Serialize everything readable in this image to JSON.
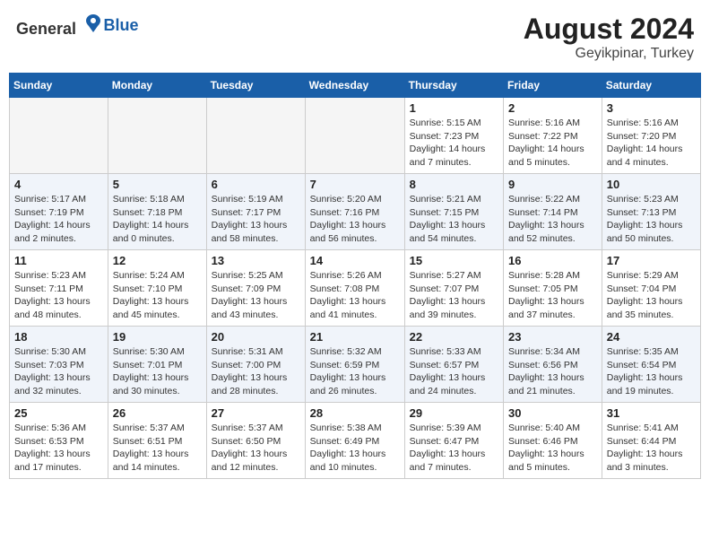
{
  "header": {
    "logo_general": "General",
    "logo_blue": "Blue",
    "month_year": "August 2024",
    "location": "Geyikpinar, Turkey"
  },
  "weekdays": [
    "Sunday",
    "Monday",
    "Tuesday",
    "Wednesday",
    "Thursday",
    "Friday",
    "Saturday"
  ],
  "weeks": [
    {
      "days": [
        {
          "date": "",
          "info": ""
        },
        {
          "date": "",
          "info": ""
        },
        {
          "date": "",
          "info": ""
        },
        {
          "date": "",
          "info": ""
        },
        {
          "date": "1",
          "info": "Sunrise: 5:15 AM\nSunset: 7:23 PM\nDaylight: 14 hours\nand 7 minutes."
        },
        {
          "date": "2",
          "info": "Sunrise: 5:16 AM\nSunset: 7:22 PM\nDaylight: 14 hours\nand 5 minutes."
        },
        {
          "date": "3",
          "info": "Sunrise: 5:16 AM\nSunset: 7:20 PM\nDaylight: 14 hours\nand 4 minutes."
        }
      ]
    },
    {
      "days": [
        {
          "date": "4",
          "info": "Sunrise: 5:17 AM\nSunset: 7:19 PM\nDaylight: 14 hours\nand 2 minutes."
        },
        {
          "date": "5",
          "info": "Sunrise: 5:18 AM\nSunset: 7:18 PM\nDaylight: 14 hours\nand 0 minutes."
        },
        {
          "date": "6",
          "info": "Sunrise: 5:19 AM\nSunset: 7:17 PM\nDaylight: 13 hours\nand 58 minutes."
        },
        {
          "date": "7",
          "info": "Sunrise: 5:20 AM\nSunset: 7:16 PM\nDaylight: 13 hours\nand 56 minutes."
        },
        {
          "date": "8",
          "info": "Sunrise: 5:21 AM\nSunset: 7:15 PM\nDaylight: 13 hours\nand 54 minutes."
        },
        {
          "date": "9",
          "info": "Sunrise: 5:22 AM\nSunset: 7:14 PM\nDaylight: 13 hours\nand 52 minutes."
        },
        {
          "date": "10",
          "info": "Sunrise: 5:23 AM\nSunset: 7:13 PM\nDaylight: 13 hours\nand 50 minutes."
        }
      ]
    },
    {
      "days": [
        {
          "date": "11",
          "info": "Sunrise: 5:23 AM\nSunset: 7:11 PM\nDaylight: 13 hours\nand 48 minutes."
        },
        {
          "date": "12",
          "info": "Sunrise: 5:24 AM\nSunset: 7:10 PM\nDaylight: 13 hours\nand 45 minutes."
        },
        {
          "date": "13",
          "info": "Sunrise: 5:25 AM\nSunset: 7:09 PM\nDaylight: 13 hours\nand 43 minutes."
        },
        {
          "date": "14",
          "info": "Sunrise: 5:26 AM\nSunset: 7:08 PM\nDaylight: 13 hours\nand 41 minutes."
        },
        {
          "date": "15",
          "info": "Sunrise: 5:27 AM\nSunset: 7:07 PM\nDaylight: 13 hours\nand 39 minutes."
        },
        {
          "date": "16",
          "info": "Sunrise: 5:28 AM\nSunset: 7:05 PM\nDaylight: 13 hours\nand 37 minutes."
        },
        {
          "date": "17",
          "info": "Sunrise: 5:29 AM\nSunset: 7:04 PM\nDaylight: 13 hours\nand 35 minutes."
        }
      ]
    },
    {
      "days": [
        {
          "date": "18",
          "info": "Sunrise: 5:30 AM\nSunset: 7:03 PM\nDaylight: 13 hours\nand 32 minutes."
        },
        {
          "date": "19",
          "info": "Sunrise: 5:30 AM\nSunset: 7:01 PM\nDaylight: 13 hours\nand 30 minutes."
        },
        {
          "date": "20",
          "info": "Sunrise: 5:31 AM\nSunset: 7:00 PM\nDaylight: 13 hours\nand 28 minutes."
        },
        {
          "date": "21",
          "info": "Sunrise: 5:32 AM\nSunset: 6:59 PM\nDaylight: 13 hours\nand 26 minutes."
        },
        {
          "date": "22",
          "info": "Sunrise: 5:33 AM\nSunset: 6:57 PM\nDaylight: 13 hours\nand 24 minutes."
        },
        {
          "date": "23",
          "info": "Sunrise: 5:34 AM\nSunset: 6:56 PM\nDaylight: 13 hours\nand 21 minutes."
        },
        {
          "date": "24",
          "info": "Sunrise: 5:35 AM\nSunset: 6:54 PM\nDaylight: 13 hours\nand 19 minutes."
        }
      ]
    },
    {
      "days": [
        {
          "date": "25",
          "info": "Sunrise: 5:36 AM\nSunset: 6:53 PM\nDaylight: 13 hours\nand 17 minutes."
        },
        {
          "date": "26",
          "info": "Sunrise: 5:37 AM\nSunset: 6:51 PM\nDaylight: 13 hours\nand 14 minutes."
        },
        {
          "date": "27",
          "info": "Sunrise: 5:37 AM\nSunset: 6:50 PM\nDaylight: 13 hours\nand 12 minutes."
        },
        {
          "date": "28",
          "info": "Sunrise: 5:38 AM\nSunset: 6:49 PM\nDaylight: 13 hours\nand 10 minutes."
        },
        {
          "date": "29",
          "info": "Sunrise: 5:39 AM\nSunset: 6:47 PM\nDaylight: 13 hours\nand 7 minutes."
        },
        {
          "date": "30",
          "info": "Sunrise: 5:40 AM\nSunset: 6:46 PM\nDaylight: 13 hours\nand 5 minutes."
        },
        {
          "date": "31",
          "info": "Sunrise: 5:41 AM\nSunset: 6:44 PM\nDaylight: 13 hours\nand 3 minutes."
        }
      ]
    }
  ]
}
